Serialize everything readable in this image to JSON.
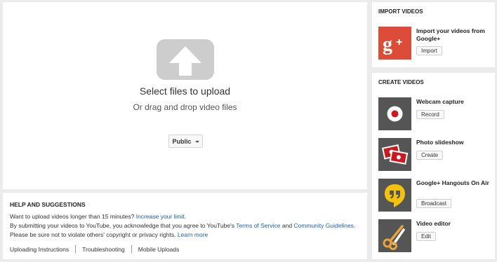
{
  "upload": {
    "title": "Select files to upload",
    "subtitle": "Or drag and drop video files",
    "privacy_label": "Public"
  },
  "help": {
    "title": "HELP AND SUGGESTIONS",
    "line1_text": "Want to upload videos longer than 15 minutes?",
    "line1_link": "Increase your limit.",
    "line2_text": "By submitting your videos to YouTube, you acknowledge that you agree to YouTube's",
    "line2_link1": "Terms of Service",
    "line2_and": "and",
    "line2_link2": "Community Guidelines",
    "line2_end": ".",
    "line3_text": "Please be sure not to violate others' copyright or privacy rights.",
    "line3_link": "Learn more",
    "links": [
      "Uploading Instructions",
      "Troubleshooting",
      "Mobile Uploads"
    ]
  },
  "import": {
    "title": "IMPORT VIDEOS",
    "item_label": "Import your videos from Google+",
    "button": "Import",
    "icon": "google-plus-icon",
    "color": "#dd4b39"
  },
  "create": {
    "title": "CREATE VIDEOS",
    "items": [
      {
        "label": "Webcam capture",
        "button": "Record",
        "icon": "record-icon"
      },
      {
        "label": "Photo slideshow",
        "button": "Create",
        "icon": "photos-icon"
      },
      {
        "label": "Google+ Hangouts On Air",
        "button": "Broadcast",
        "icon": "hangouts-icon"
      },
      {
        "label": "Video editor",
        "button": "Edit",
        "icon": "scissors-icon"
      }
    ],
    "thumb_color": "#555555",
    "hangouts_color": "#f4c20d"
  }
}
